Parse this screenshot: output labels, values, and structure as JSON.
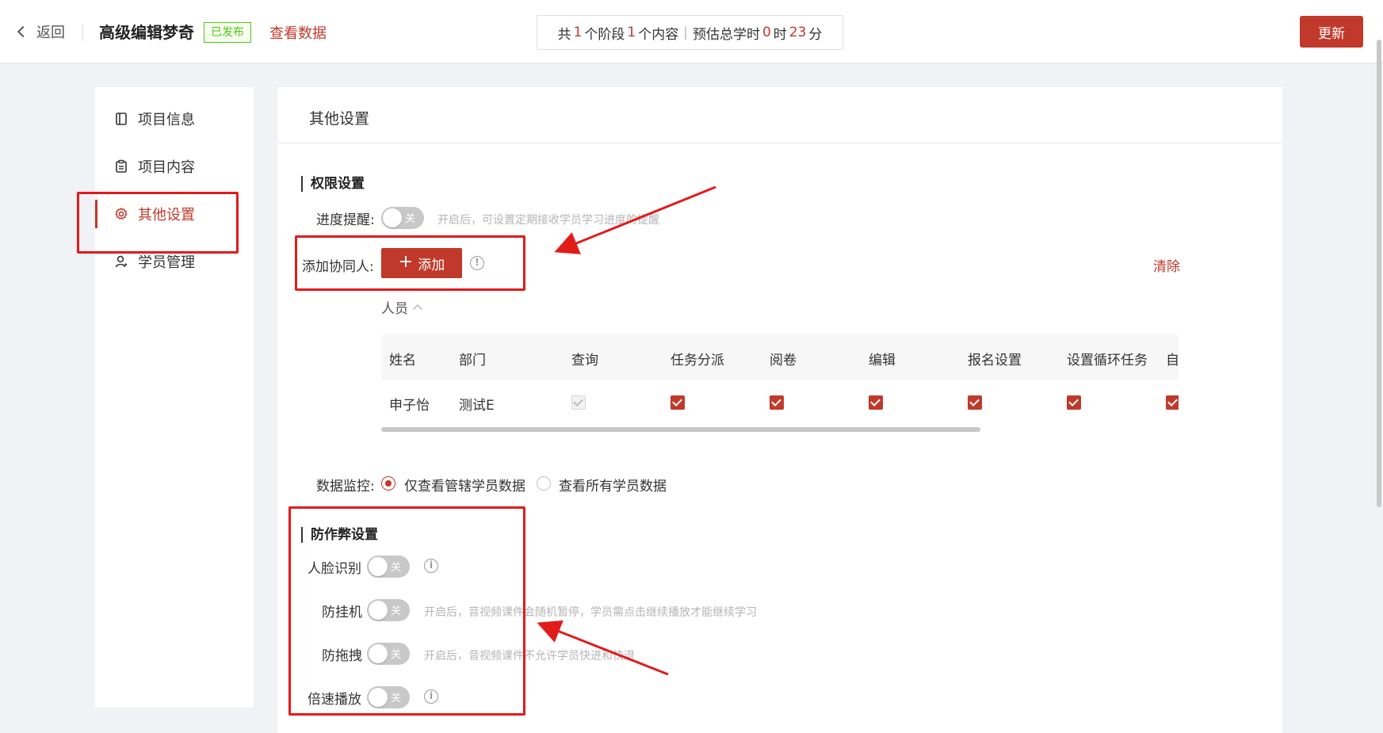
{
  "header": {
    "back_label": "返回",
    "project_title": "高级编辑梦奇",
    "status_badge": "已发布",
    "view_data_label": "查看数据",
    "summary": {
      "prefix": "共",
      "stages": "1",
      "stages_unit": "个阶段",
      "contents": "1",
      "contents_unit": "个内容",
      "separator": "|",
      "estimate_label": "预估总学时",
      "hours": "0",
      "hours_unit": "时",
      "minutes": "23",
      "minutes_unit": "分"
    },
    "update_label": "更新"
  },
  "sidebar": {
    "items": [
      {
        "label": "项目信息",
        "icon": "book-icon"
      },
      {
        "label": "项目内容",
        "icon": "clipboard-icon"
      },
      {
        "label": "其他设置",
        "icon": "gear-icon",
        "active": true
      },
      {
        "label": "学员管理",
        "icon": "user-icon"
      }
    ]
  },
  "main": {
    "title": "其他设置",
    "permissions": {
      "section_title": "权限设置",
      "progress_reminder": {
        "label": "进度提醒:",
        "switch_text": "关",
        "hint": "开启后，可设置定期接收学员学习进度的提醒"
      },
      "add_collaborator": {
        "label": "添加协同人:",
        "button_label": "添加",
        "button_plus": "+",
        "info_glyph": "!",
        "clear_label": "清除"
      },
      "people_toggle": "人员",
      "table": {
        "headers": [
          "姓名",
          "部门",
          "查询",
          "任务分派",
          "阅卷",
          "编辑",
          "报名设置",
          "设置循环任务",
          "自动"
        ],
        "rows": [
          {
            "name": "申子怡",
            "dept": "测试E",
            "query": "checked-disabled",
            "assign": "checked",
            "grading": "checked",
            "edit": "checked",
            "signup": "checked",
            "loop": "checked",
            "auto": "checked"
          }
        ]
      },
      "data_monitor": {
        "label": "数据监控:",
        "options": [
          "仅查看管辖学员数据",
          "查看所有学员数据"
        ],
        "selected": "仅查看管辖学员数据"
      }
    },
    "anticheat": {
      "section_title": "防作弊设置",
      "face_recognition": {
        "label": "人脸识别",
        "switch_text": "关",
        "info_glyph": "i"
      },
      "anti_idle": {
        "label": "防挂机",
        "switch_text": "关",
        "hint": "开启后，音视频课件会随机暂停，学员需点击继续播放才能继续学习"
      },
      "anti_drag": {
        "label": "防拖拽",
        "switch_text": "关",
        "hint": "开启后，音视频课件不允许学员快进和快退"
      },
      "speed_play": {
        "label": "倍速播放",
        "switch_text": "关",
        "info_glyph": "i"
      }
    }
  },
  "colors": {
    "accent": "#c0392b",
    "annotation": "#e21b1b",
    "badge_green": "#52c41a",
    "switch_off": "#c8c8c8"
  }
}
